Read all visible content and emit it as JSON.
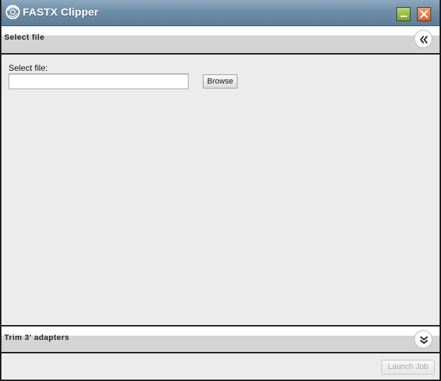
{
  "window": {
    "title": "FASTX Clipper",
    "titlebar_color": "#6f8fa8",
    "minimize_icon": "minimize-icon",
    "close_icon": "close-icon"
  },
  "sections": [
    {
      "title": "Select file",
      "toggle_icon": "double-chevron-left-icon",
      "expanded": true
    },
    {
      "title": "Trim 3' adapters",
      "toggle_icon": "double-chevron-down-icon",
      "expanded": false
    }
  ],
  "select_file": {
    "label": "Select file:",
    "value": "",
    "placeholder": "",
    "browse_label": "Browse"
  },
  "footer": {
    "launch_label": "Launch Job",
    "launch_enabled": false
  }
}
